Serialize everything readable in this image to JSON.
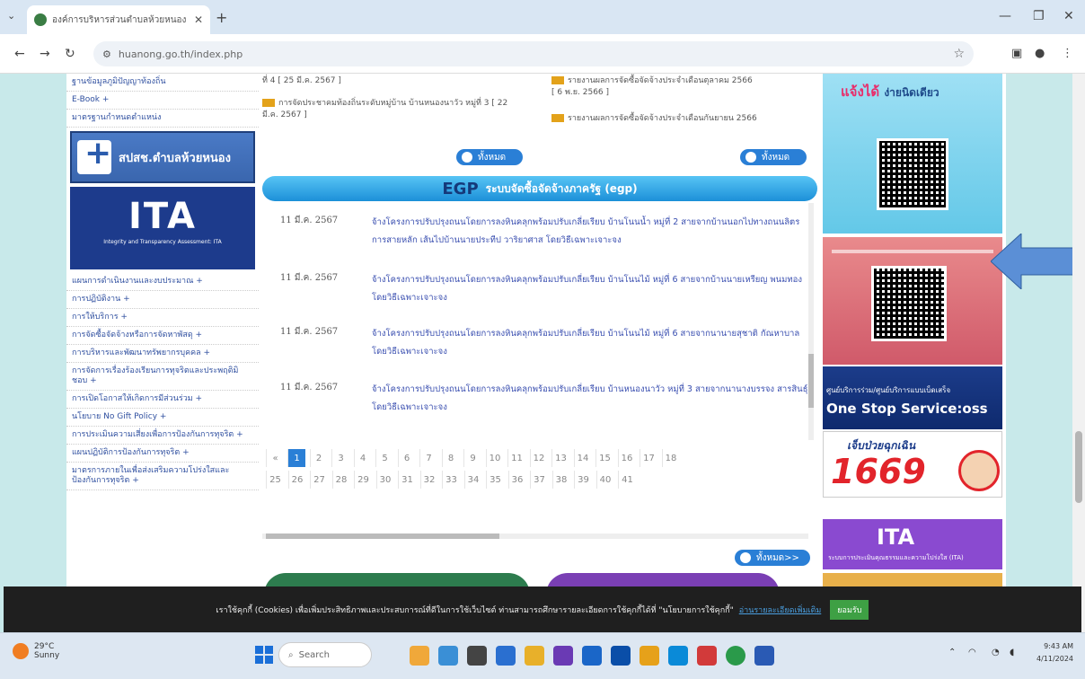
{
  "browser": {
    "tab_title": "องค์การบริหารส่วนตำบลห้วยหนอง",
    "url": "huanong.go.th/index.php"
  },
  "left_menu": {
    "top_items": [
      "ฐานข้อมูลภูมิปัญญาท้องถิ่น",
      "E-Book +",
      "มาตรฐานกำหนดตำแหน่ง"
    ],
    "banner_nhso": "สปสช.ตำบลห้วยหนอง",
    "banner_ita": "ITA",
    "banner_ita_sub": "Integrity and Transparency Assessment: ITA",
    "items": [
      "แผนการดำเนินงานและงบประมาณ +",
      "การปฏิบัติงาน +",
      "การให้บริการ +",
      "การจัดซื้อจัดจ้างหรือการจัดหาพัสดุ +",
      "การบริหารและพัฒนาทรัพยากรบุคคล +",
      "การจัดการเรื่องร้องเรียนการทุจริตและประพฤติมิชอบ +",
      "การเปิดโอกาสให้เกิดการมีส่วนร่วม +",
      "นโยบาย No Gift Policy +",
      "การประเมินความเสี่ยงเพื่อการป้องกันการทุจริต +",
      "แผนปฏิบัติการป้องกันการทุจริต +",
      "มาตรการภายในเพื่อส่งเสริมความโปร่งใสและป้องกันการทุจริต +"
    ]
  },
  "news": {
    "left_col": {
      "top_text": "ที่ 4",
      "top_date": "[ 25 มี.ค. 2567 ]",
      "item": "การจัดประชาคมท้องถิ่นระดับหมู่บ้าน บ้านหนองนาวัว หมู่ที่ 3",
      "item_date": "[ 22 มี.ค. 2567 ]"
    },
    "right_col": {
      "item1": "รายงานผลการจัดซื้อจัดจ้างประจำเดือนตุลาคม 2566",
      "item1_date": "[ 6 พ.ย. 2566 ]",
      "item2": "รายงานผลการจัดซื้อจัดจ้างประจำเดือนกันยายน 2566"
    },
    "more_label": "ทั้งหมด",
    "more_label2": "ทั้งหมด>>"
  },
  "egp": {
    "logo": "EGP",
    "title": "ระบบจัดซื้อจัดจ้างภาครัฐ (egp)",
    "rows": [
      {
        "date": "11 มี.ค. 2567",
        "text": "จ้างโครงการปรับปรุงถนนโดยการลงหินคลุกพร้อมปรับเกลี่ยเรียบ บ้านโนนน้ำ หมู่ที่ 2 สายจากบ้านนอกไปทางถนนลิตรการสายหลัก เส้นไปบ้านนายประทีป วาริยาศาส โดยวิธีเฉพาะเจาะจง"
      },
      {
        "date": "11 มี.ค. 2567",
        "text": "จ้างโครงการปรับปรุงถนนโดยการลงหินคลุกพร้อมปรับเกลี่ยเรียบ บ้านโนนไม้ หมู่ที่ 6 สายจากบ้านนายเหรียญ พนมทอง โดยวิธีเฉพาะเจาะจง"
      },
      {
        "date": "11 มี.ค. 2567",
        "text": "จ้างโครงการปรับปรุงถนนโดยการลงหินคลุกพร้อมปรับเกลี่ยเรียบ บ้านโนนไม้ หมู่ที่ 6 สายจากนานายสุชาติ กัณหาบาล โดยวิธีเฉพาะเจาะจง"
      },
      {
        "date": "11 มี.ค. 2567",
        "text": "จ้างโครงการปรับปรุงถนนโดยการลงหินคลุกพร้อมปรับเกลี่ยเรียบ บ้านหนองนาวัว หมู่ที่ 3 สายจากนานางบรรจง สารสินธุ์ โดยวิธีเฉพาะเจาะจง"
      }
    ],
    "pages_row1": [
      "1",
      "2",
      "3",
      "4",
      "5",
      "6",
      "7",
      "8",
      "9",
      "10",
      "11",
      "12",
      "13",
      "14",
      "15",
      "16",
      "17",
      "18"
    ],
    "pages_row2": [
      "25",
      "26",
      "27",
      "28",
      "29",
      "30",
      "31",
      "32",
      "33",
      "34",
      "35",
      "36",
      "37",
      "38",
      "39",
      "40",
      "41"
    ],
    "active_page": "1"
  },
  "right_banners": {
    "report": "แจ้งได้",
    "report_sub": "ง่ายนิดเดียว",
    "oss_top": "ศูนย์บริการร่วม/ศูนย์บริการแบบเบ็ดเสร็จ",
    "oss": "One Stop Service:oss",
    "hotline_top": "เจ็บป่วยฉุกเฉิน",
    "hotline": "1669",
    "ita": "ITA",
    "ita_sub": "ระบบการประเมินคุณธรรมและความโปร่งใส (ITA)"
  },
  "cookie_bar": {
    "text": "เราใช้คุกกี้ (Cookies) เพื่อเพิ่มประสิทธิภาพและประสบการณ์ที่ดีในการใช้เว็บไซต์ ท่านสามารถศึกษารายละเอียดการใช้คุกกี้ได้ที่ \"นโยบายการใช้คุกกี้\"",
    "link": "อ่านรายละเอียดเพิ่มเติม",
    "accept": "ยอมรับ"
  },
  "taskbar": {
    "weather_temp": "29°C",
    "weather_desc": "Sunny",
    "search": "Search",
    "time": "9:43 AM",
    "date": "4/11/2024"
  }
}
